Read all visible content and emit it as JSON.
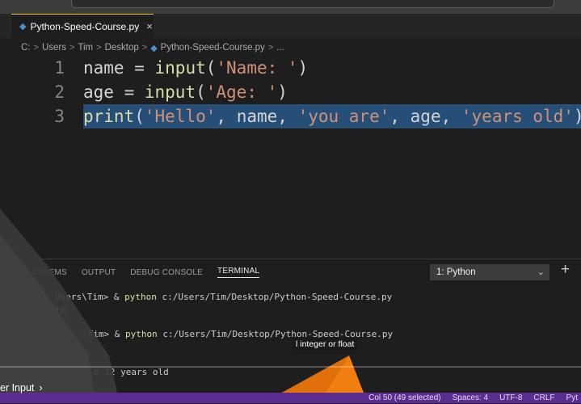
{
  "window": {
    "tab_title": "Python-Speed-Course.py",
    "tab_close": "×"
  },
  "breadcrumb": {
    "parts": [
      "C:",
      "Users",
      "Tim",
      "Desktop",
      "Python-Speed-Course.py",
      "..."
    ],
    "separator": ">"
  },
  "editor": {
    "lines": [
      {
        "number": "1",
        "tokens": [
          [
            "name",
            "id"
          ],
          [
            " = ",
            "p"
          ],
          [
            "input",
            "fn"
          ],
          [
            "(",
            "p"
          ],
          [
            "'Name: '",
            "str"
          ],
          [
            ")",
            "p"
          ]
        ]
      },
      {
        "number": "2",
        "tokens": [
          [
            "age",
            "id"
          ],
          [
            " = ",
            "p"
          ],
          [
            "input",
            "fn"
          ],
          [
            "(",
            "p"
          ],
          [
            "'Age: '",
            "str"
          ],
          [
            ")",
            "p"
          ]
        ]
      },
      {
        "number": "3",
        "selected": true,
        "tokens": [
          [
            "print",
            "fn"
          ],
          [
            "(",
            "p"
          ],
          [
            "'Hello'",
            "str"
          ],
          [
            ", ",
            "p"
          ],
          [
            "name",
            "id"
          ],
          [
            ", ",
            "p"
          ],
          [
            "'you are'",
            "str"
          ],
          [
            ", ",
            "p"
          ],
          [
            "age",
            "id"
          ],
          [
            ", ",
            "p"
          ],
          [
            "'years old'",
            "str"
          ],
          [
            ")",
            "p"
          ]
        ]
      }
    ]
  },
  "panel": {
    "tabs": [
      "OBLEMS",
      "OUTPUT",
      "DEBUG CONSOLE",
      "TERMINAL"
    ],
    "active_tab": "TERMINAL",
    "terminal_select": "1: Python",
    "add_label": "+",
    "terminal_lines": [
      {
        "prefix": "Users\\Tim> & ",
        "cmd": "python",
        "rest": " c:/Users/Tim/Desktop/Python-Speed-Course.py"
      },
      {
        "prefix": "im",
        "cmd": "",
        "rest": ""
      },
      {
        "prefix": "\\Tim> & ",
        "cmd": "python",
        "rest": " c:/Users/Tim/Desktop/Python-Speed-Course.py"
      },
      {
        "prefix": "e 12 years old",
        "cmd": "",
        "rest": ""
      }
    ]
  },
  "tooltip": {
    "text": "l integer or float"
  },
  "status": {
    "items": [
      "Col 50 (49 selected)",
      "Spaces: 4",
      "UTF-8",
      "CRLF",
      "Pyt"
    ]
  },
  "video_overlay": {
    "chapter_label": "er Input",
    "chevron": "›"
  },
  "colors": {
    "editor_bg": "#1e1e1e",
    "selection": "#264f78",
    "statusbar": "#5c2d91",
    "string": "#ce9178",
    "function": "#dcdcaa",
    "accent_orange": "#e0700c"
  }
}
